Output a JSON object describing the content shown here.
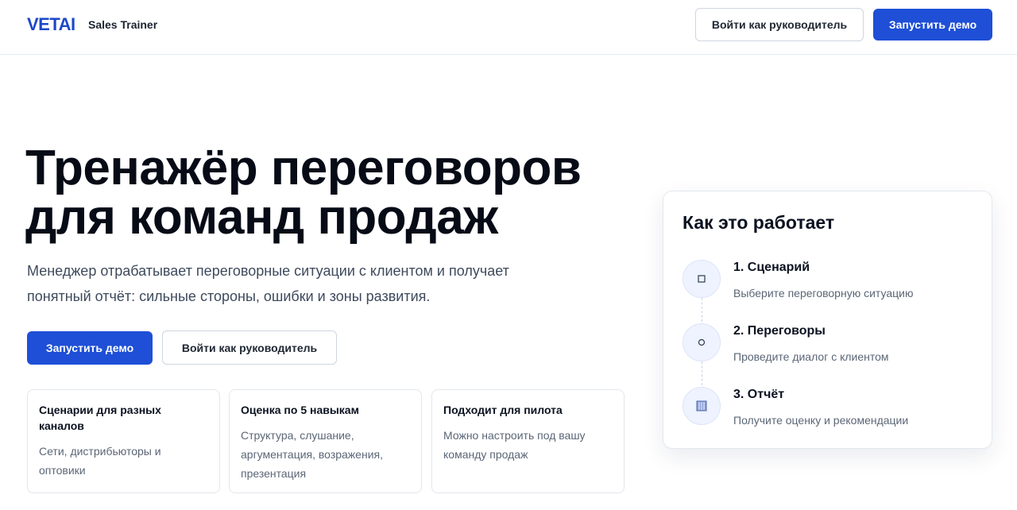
{
  "header": {
    "logo": "VETAI",
    "product": "Sales Trainer",
    "login_label": "Войти как руководитель",
    "demo_label": "Запустить демо"
  },
  "hero": {
    "title_line1": "Тренажёр переговоров",
    "title_line2": "для команд продаж",
    "subtitle_line1": "Менеджер отрабатывает переговорные ситуации с клиентом и получает",
    "subtitle_line2": "понятный отчёт: сильные стороны, ошибки и зоны развития.",
    "demo_label": "Запустить демо",
    "login_label": "Войти как руководитель"
  },
  "features": [
    {
      "title_line1": "Сценарии для разных",
      "title_line2": "каналов",
      "text_line1": "Сети, дистрибьюторы и",
      "text_line2": "оптовики",
      "text_line3": ""
    },
    {
      "title_line1": "Оценка по 5 навыкам",
      "title_line2": "",
      "text_line1": "Структура, слушание,",
      "text_line2": "аргументация, возражения,",
      "text_line3": "презентация"
    },
    {
      "title_line1": "Подходит для пилота",
      "title_line2": "",
      "text_line1": "Можно настроить под вашу",
      "text_line2": "команду продаж",
      "text_line3": ""
    }
  ],
  "how_it_works": {
    "title": "Как это работает",
    "steps": [
      {
        "icon": "square-icon",
        "title": "1. Сценарий",
        "desc": "Выберите переговорную ситуацию"
      },
      {
        "icon": "circle-icon",
        "title": "2. Переговоры",
        "desc": "Проведите диалог с клиентом"
      },
      {
        "icon": "report-icon",
        "title": "3. Отчёт",
        "desc": "Получите оценку и рекомендации"
      }
    ]
  },
  "colors": {
    "accent": "#1e4fd6",
    "logo": "#1d47c9",
    "text_muted": "#5b6676"
  }
}
